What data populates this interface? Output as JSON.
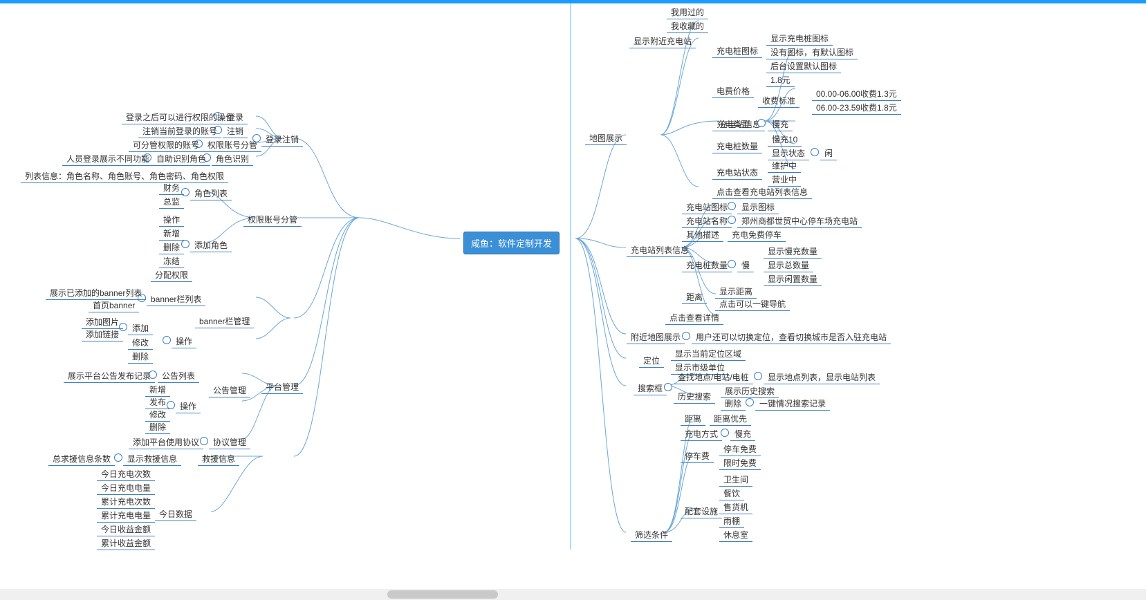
{
  "root": "咸鱼：软件定制开发",
  "left": {
    "login": {
      "title": "登录注销",
      "items": [
        {
          "label": "登录",
          "desc": "登录之后可以进行权限的操作"
        },
        {
          "label": "注销",
          "desc": "注销当前登录的账号"
        },
        {
          "label": "权限账号分管",
          "desc": "可分管权限的账号"
        },
        {
          "label": "角色识别",
          "desc": "人员登录展示不同功能",
          "sub": "自助识别角色"
        }
      ]
    },
    "role": {
      "title": "权限账号分管",
      "listDesc": "列表信息：角色名称、角色账号、角色密码、角色权限",
      "list": {
        "label": "角色列表",
        "items": [
          "财务",
          "总监"
        ]
      },
      "add": {
        "label": "添加角色",
        "items": [
          "操作",
          "新增",
          "删除",
          "冻结",
          "分配权限"
        ]
      }
    },
    "platform": {
      "title": "平台管理",
      "banner": {
        "title": "banner栏管理",
        "list": {
          "label": "banner栏列表",
          "items": [
            "展示已添加的banner列表",
            "首页banner"
          ]
        },
        "op": {
          "label": "操作",
          "add": {
            "label": "添加",
            "items": [
              "添加图片",
              "添加链接"
            ]
          },
          "items": [
            "修改",
            "删除"
          ]
        }
      },
      "notice": {
        "title": "公告管理",
        "list": {
          "label": "公告列表",
          "desc": "展示平台公告发布记录"
        },
        "op": {
          "label": "操作",
          "items": [
            "新增",
            "发布",
            "修改",
            "删除"
          ]
        }
      },
      "protocol": {
        "label": "协议管理",
        "desc": "添加平台使用协议"
      }
    },
    "rescue": {
      "title": "救援信息",
      "show": {
        "label": "显示救援信息",
        "desc": "总求援信息条数"
      },
      "today": {
        "label": "今日数据",
        "items": [
          "今日充电次数",
          "今日充电电量",
          "累计充电次数",
          "累计充电电量",
          "今日收益金额",
          "累计收益金额"
        ]
      }
    }
  },
  "right": {
    "map": {
      "title": "地图展示",
      "used": [
        "我用过的",
        "我收藏的"
      ],
      "nearby": {
        "label": "显示附近充电站"
      },
      "stationInfo": {
        "label": "充电站信息",
        "icon": {
          "label": "充电桩图标",
          "items": [
            "显示充电桩图标",
            "没有图标，有默认图标",
            "后台设置默认图标"
          ]
        },
        "price": {
          "label": "电费价格",
          "value": "1.8元",
          "std": {
            "label": "收费标准",
            "items": [
              "00.00-06.00收费1.3元",
              "06.00-23.59收费1.8元"
            ]
          }
        },
        "type": {
          "label": "充电类型",
          "value": "慢充"
        },
        "count": {
          "label": "充电桩数量",
          "value": "慢充10",
          "state": {
            "label": "显示状态",
            "value": "闲"
          }
        },
        "status": {
          "label": "充电站状态",
          "items": [
            "维护中",
            "营业中"
          ]
        },
        "click": "点击查看充电站列表信息"
      }
    },
    "stationList": {
      "label": "充电站列表信息",
      "icon": {
        "label": "充电站图标",
        "value": "显示图标"
      },
      "name": {
        "label": "充电站名称",
        "value": "郑州商都世贸中心停车场充电站"
      },
      "other": {
        "label": "其他描述",
        "value": "充电免费停车"
      },
      "count": {
        "label": "充电桩数量",
        "value": "慢",
        "items": [
          "显示慢充数量",
          "显示总数量",
          "显示闲置数量"
        ]
      },
      "distance": {
        "label": "距离",
        "items": [
          "显示距离",
          "点击可以一键导航"
        ]
      },
      "detail": "点击查看详情"
    },
    "nearMap": {
      "label": "附近地图展示",
      "value": "用户还可以切换定位，查看切换城市是否入驻充电站"
    },
    "locate": {
      "label": "定位",
      "items": [
        "显示当前定位区域",
        "显示市级单位"
      ]
    },
    "search": {
      "label": "搜索框",
      "find": {
        "label": "查找地点/电站/电桩",
        "value": "显示地点列表，显示电站列表"
      },
      "history": {
        "label": "历史搜索",
        "items": [
          "展示历史搜索"
        ],
        "del": {
          "label": "删除",
          "value": "一键情况搜索记录"
        }
      }
    },
    "filter": {
      "label": "筛选条件",
      "distance": {
        "label": "距离",
        "value": "距离优先"
      },
      "mode": {
        "label": "充电方式",
        "value": "慢充"
      },
      "park": {
        "label": "停车费",
        "items": [
          "停车免费",
          "限时免费"
        ]
      },
      "facility": {
        "label": "配套设施",
        "items": [
          "卫生间",
          "餐饮",
          "售货机",
          "雨棚",
          "休息室"
        ]
      }
    }
  }
}
